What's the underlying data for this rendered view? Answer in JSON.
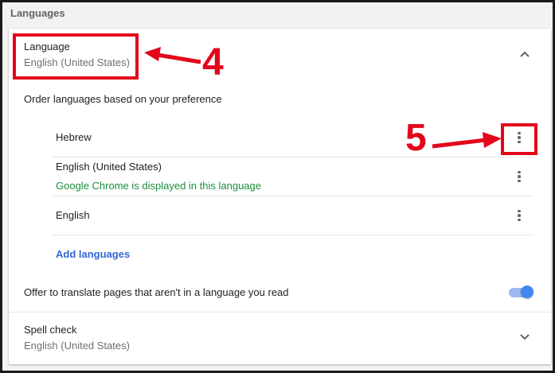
{
  "section": {
    "title": "Languages"
  },
  "language": {
    "label": "Language",
    "value": "English (United States)",
    "expand_icon": "chevron-up-icon",
    "order_hint": "Order languages based on your preference",
    "items": [
      {
        "name": "Hebrew",
        "note": ""
      },
      {
        "name": "English (United States)",
        "note": "Google Chrome is displayed in this language"
      },
      {
        "name": "English",
        "note": ""
      }
    ],
    "add_label": "Add languages",
    "more_icon": "more-vert-icon"
  },
  "translate": {
    "label": "Offer to translate pages that aren't in a language you read",
    "enabled": true
  },
  "spellcheck": {
    "label": "Spell check",
    "value": "English (United States)",
    "expand_icon": "chevron-down-icon"
  },
  "annotations": {
    "callout_4": "4",
    "callout_5": "5"
  },
  "colors": {
    "annotation_red": "#e3061a",
    "accent_blue": "#4285f4",
    "note_green": "#1e8e3e",
    "link_blue": "#3367d6"
  }
}
